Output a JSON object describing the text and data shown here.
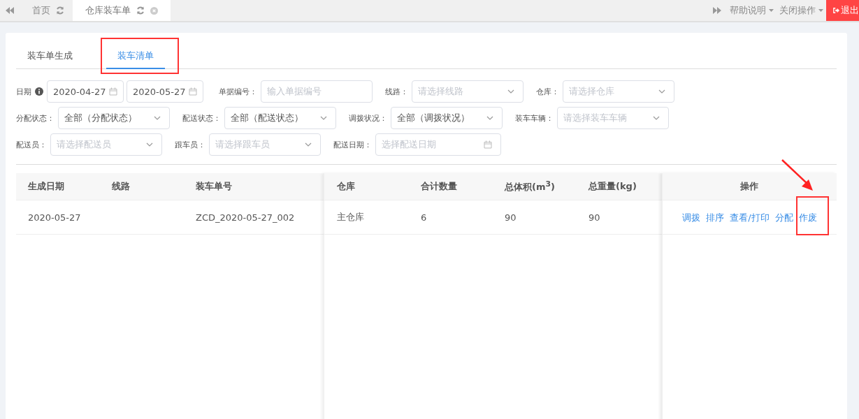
{
  "top_tabs": [
    {
      "label": "首页",
      "selected": false,
      "closable": false
    },
    {
      "label": "仓库装车单",
      "selected": true,
      "closable": true
    }
  ],
  "top_menus": [
    {
      "label": "帮助说明"
    },
    {
      "label": "关闭操作"
    }
  ],
  "logout": {
    "label": "退出"
  },
  "tabs": [
    {
      "label": "装车单生成",
      "selected": false,
      "highlighted": false
    },
    {
      "label": "装车清单",
      "selected": true,
      "highlighted": true
    }
  ],
  "filters": [
    [
      {
        "label": "日期",
        "kind": "daterange",
        "values": [
          "2020-04-27",
          "2020-05-27"
        ]
      },
      {
        "label": "单据编号：",
        "kind": "input",
        "placeholder": "输入单据编号"
      },
      {
        "label": "线路：",
        "kind": "select",
        "placeholder": "请选择线路"
      },
      {
        "label": "仓库：",
        "kind": "select",
        "placeholder": "请选择仓库"
      }
    ],
    [
      {
        "label": "分配状态：",
        "kind": "select",
        "value": "全部（分配状态）"
      },
      {
        "label": "配送状态：",
        "kind": "select",
        "value": "全部（配送状态）"
      },
      {
        "label": "调拨状况：",
        "kind": "select",
        "value": "全部（调拨状况）"
      },
      {
        "label": "装车车辆：",
        "kind": "select",
        "placeholder": "请选择装车车辆"
      }
    ],
    [
      {
        "label": "配送员：",
        "kind": "select",
        "placeholder": "请选择配送员"
      },
      {
        "label": "跟车员：",
        "kind": "select",
        "placeholder": "请选择跟车员"
      },
      {
        "label": "配送日期：",
        "kind": "date",
        "placeholder": "选择配送日期"
      }
    ]
  ],
  "table": {
    "columns_left": [
      "生成日期",
      "线路",
      "装车单号"
    ],
    "columns_middle": [
      "仓库",
      "合计数量",
      "总体积(m$^{3}$)",
      "总重量(kg)"
    ],
    "actions_header": "操作",
    "rows": [
      {
        "left": {
          "date": "2020-05-27",
          "order_no": "ZCD_2020-05-27_002"
        },
        "middle": [
          "主仓库",
          "6",
          "90",
          "90"
        ],
        "actions": [
          {
            "label": "调拨",
            "highlighted": false
          },
          {
            "label": "排序",
            "highlighted": false
          },
          {
            "label": "查看/打印",
            "highlighted": false
          },
          {
            "label": "分配",
            "highlighted": false
          },
          {
            "label": "作废",
            "highlighted": true
          }
        ]
      }
    ]
  }
}
